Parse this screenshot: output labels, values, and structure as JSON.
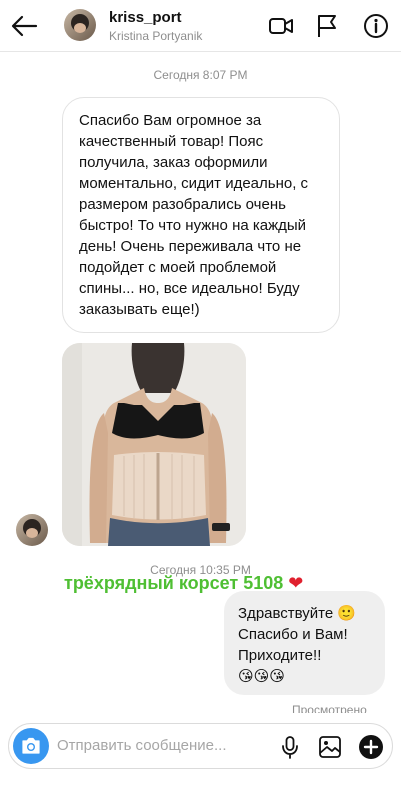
{
  "header": {
    "username": "kriss_port",
    "fullname": "Kristina Portyanik",
    "icons": [
      "back-arrow-icon",
      "video-call-icon",
      "flag-icon",
      "info-icon"
    ]
  },
  "thread": {
    "timestamp_1": "Сегодня 8:07 PM",
    "incoming_message": "Спасибо Вам огромное за качественный товар! Пояс получила, заказ оформили моментально, сидит идеально, с размером разобрались очень быстро! То что нужно на каждый день! Очень переживала что не подойдет с моей проблемой спины... но, все идеально! Буду заказывать еще!)",
    "timestamp_2": "Сегодня 10:35 PM",
    "caption": "трёхрядный корсет 5108",
    "caption_emoji": "❤",
    "outgoing_message_line1": "Здравствуйте 🙂",
    "outgoing_message_line2": "Спасибо и Вам!",
    "outgoing_message_line3": "Приходите!!",
    "outgoing_message_line4": "😘😘😘",
    "seen_label": "Просмотрено"
  },
  "composer": {
    "placeholder": "Отправить сообщение...",
    "icons": [
      "camera-icon",
      "microphone-icon",
      "gallery-icon",
      "add-icon"
    ]
  },
  "colors": {
    "accent": "#3897f0",
    "caption_green": "#4fbf33",
    "heart_red": "#e0202e",
    "outgoing_bubble": "#efefef"
  }
}
